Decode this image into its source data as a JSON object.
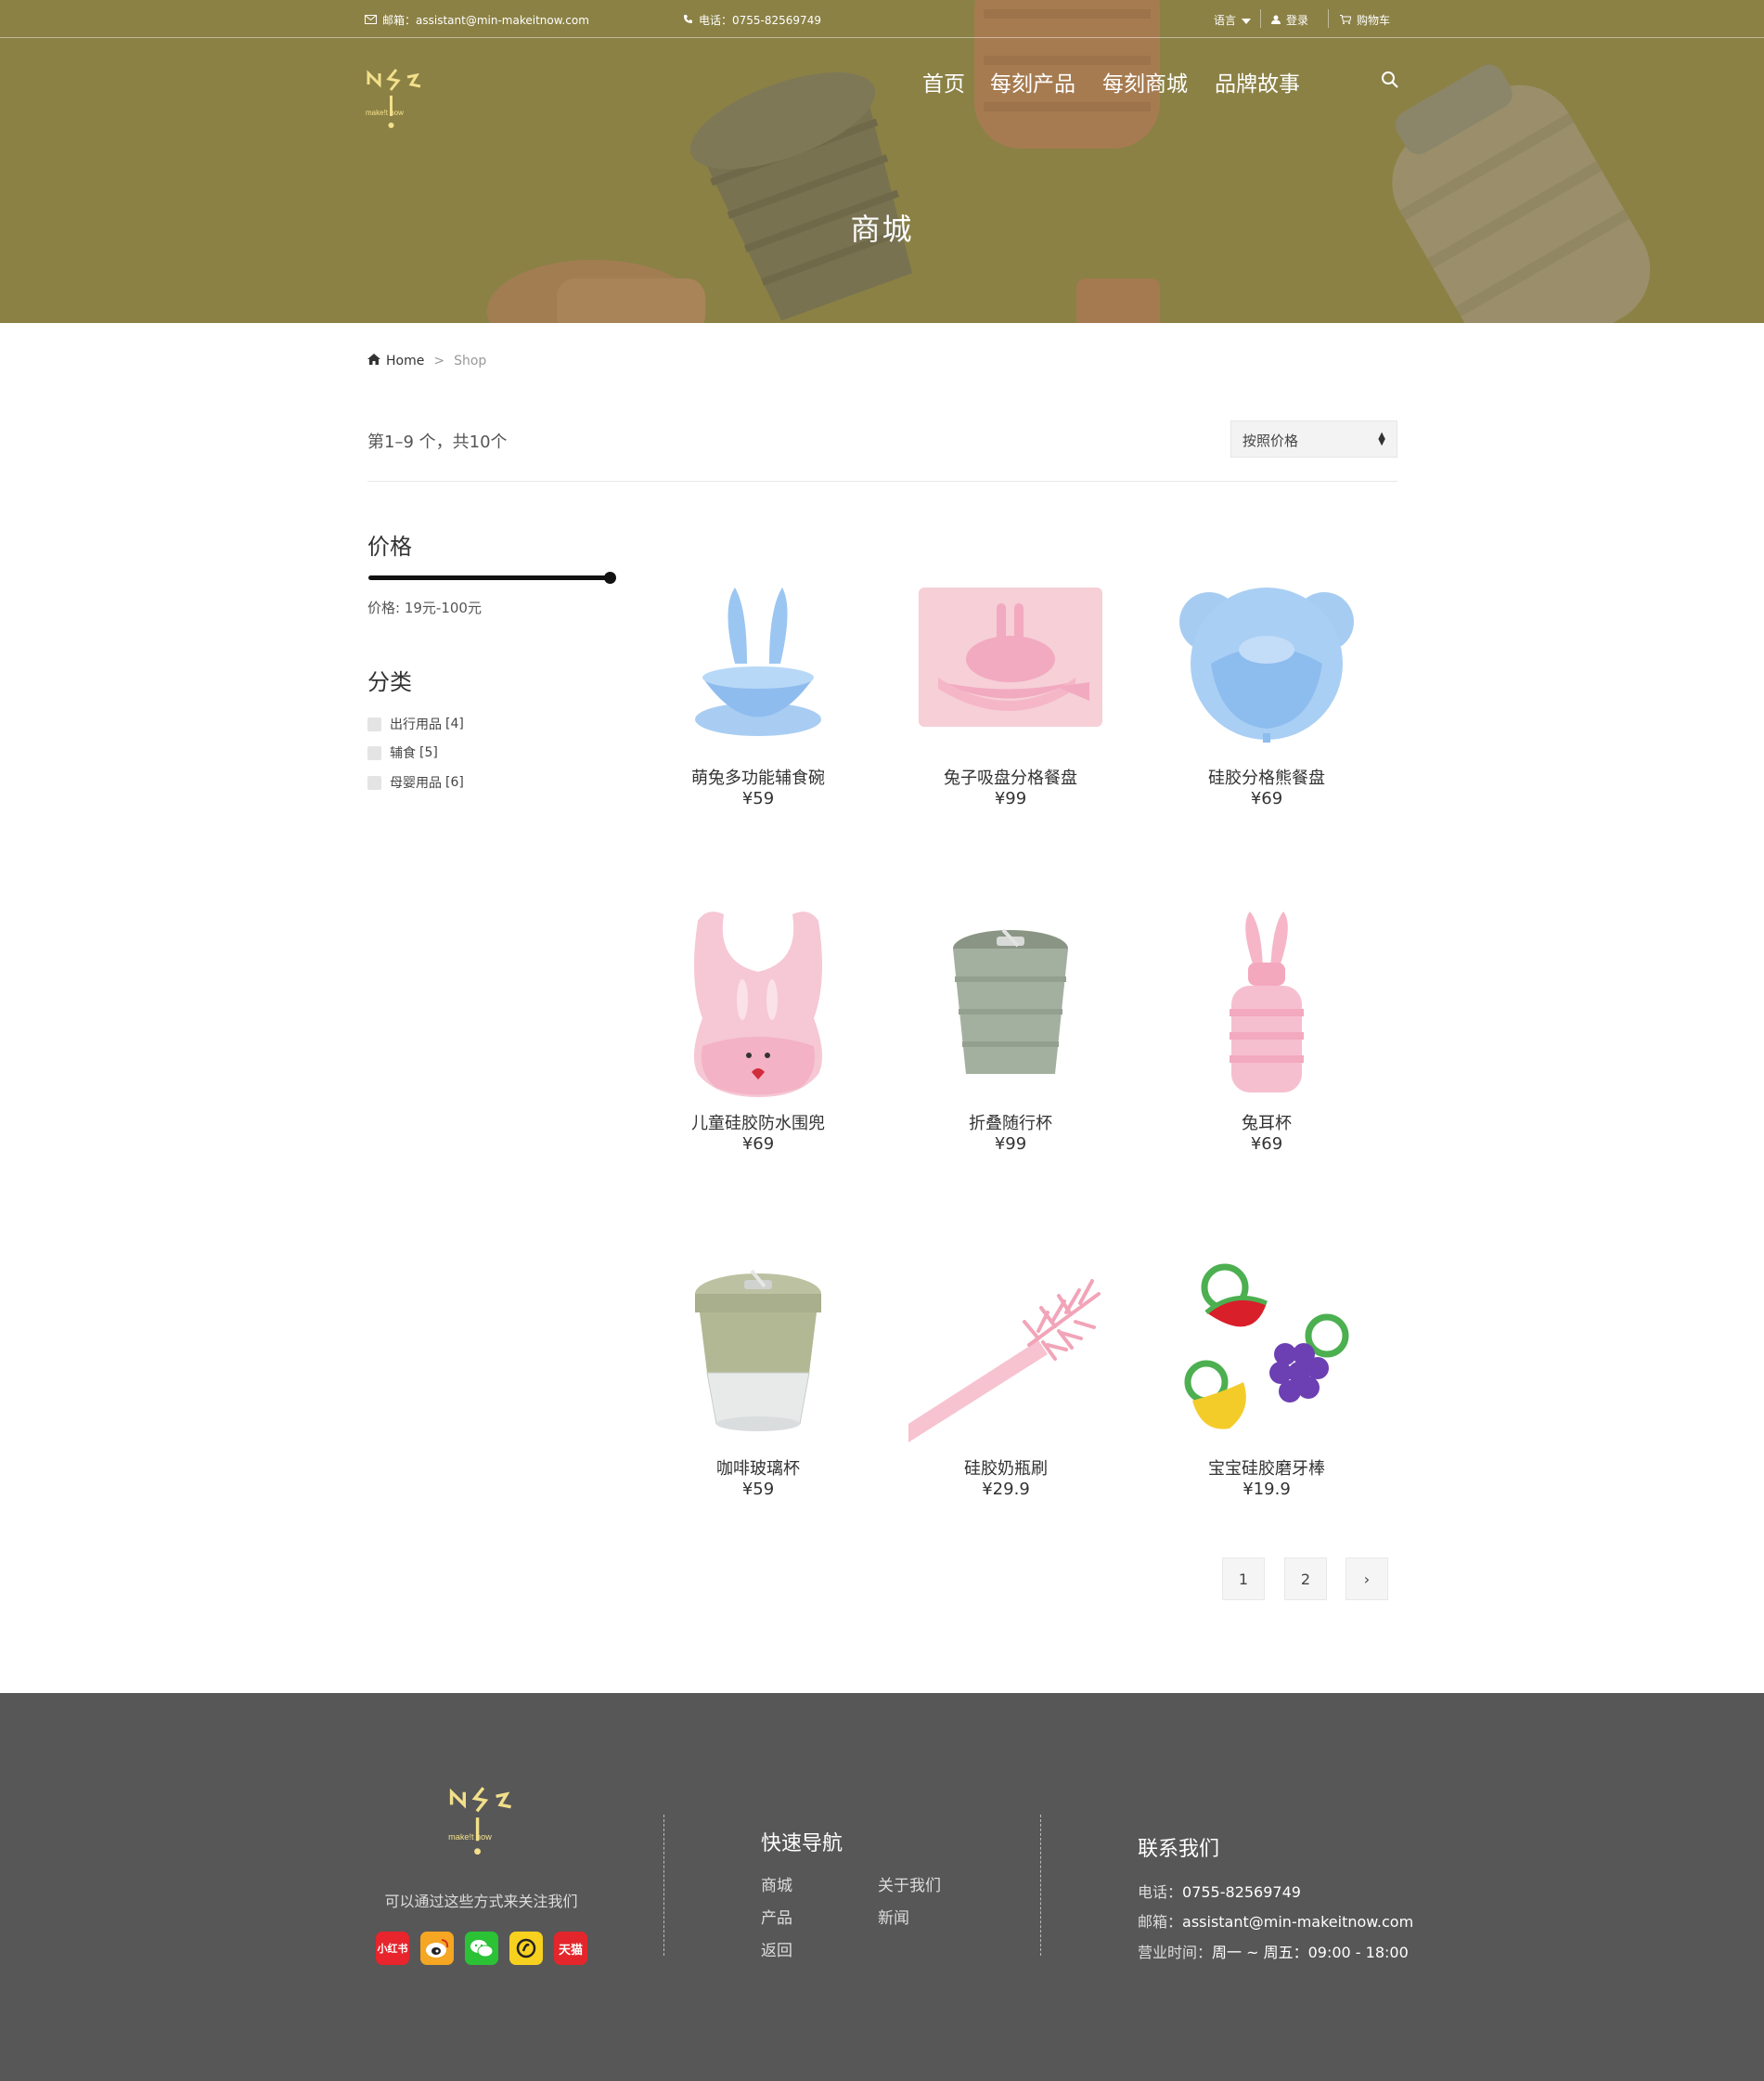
{
  "topbar": {
    "email_label": "邮箱：",
    "email": "assistant@min-makeitnow.com",
    "phone_label": "电话：",
    "phone": "0755-82569749",
    "language": "语言",
    "login": "登录",
    "cart": "购物车"
  },
  "brand": {
    "logo_text": "make!t now"
  },
  "nav": {
    "items": [
      "首页",
      "每刻产品",
      "每刻商城",
      "品牌故事"
    ]
  },
  "hero": {
    "title": "商城"
  },
  "breadcrumb": {
    "home": "Home",
    "sep": ">",
    "current": "Shop"
  },
  "toolbar": {
    "result_count": "第1–9 个，共10个",
    "sort_selected": "按照价格"
  },
  "sidebar": {
    "price_title": "价格",
    "price_label": "价格:",
    "price_range": "19元-100元",
    "price_slider": {
      "min": 19,
      "max": 100,
      "low": 19,
      "high": 100
    },
    "category_title": "分类",
    "categories": [
      {
        "label": "出行用品",
        "count": "[4]"
      },
      {
        "label": "辅食",
        "count": "[5]"
      },
      {
        "label": "母婴用品",
        "count": "[6]"
      }
    ]
  },
  "products": [
    {
      "name": "萌兔多功能辅食碗",
      "price": "¥59"
    },
    {
      "name": "兔子吸盘分格餐盘",
      "price": "¥99"
    },
    {
      "name": "硅胶分格熊餐盘",
      "price": "¥69"
    },
    {
      "name": "儿童硅胶防水围兜",
      "price": "¥69"
    },
    {
      "name": "折叠随行杯",
      "price": "¥99"
    },
    {
      "name": "兔耳杯",
      "price": "¥69"
    },
    {
      "name": "咖啡玻璃杯",
      "price": "¥59"
    },
    {
      "name": "硅胶奶瓶刷",
      "price": "¥29.9"
    },
    {
      "name": "宝宝硅胶磨牙棒",
      "price": "¥19.9"
    }
  ],
  "pagination": {
    "pages": [
      "1",
      "2"
    ],
    "next": "›"
  },
  "footer": {
    "follow_text": "可以通过这些方式来关注我们",
    "socials": [
      {
        "name": "xiaohongshu-icon",
        "label": "小红书",
        "color": "#e8242c"
      },
      {
        "name": "weibo-icon",
        "label": "",
        "color": "#f5a623"
      },
      {
        "name": "wechat-icon",
        "label": "",
        "color": "#2bc236"
      },
      {
        "name": "douyin-icon",
        "label": "",
        "color": "#f7d11e"
      },
      {
        "name": "tmall-icon",
        "label": "天猫",
        "color": "#e3262b"
      }
    ],
    "nav_title": "快速导航",
    "nav_links": [
      "商城",
      "关于我们",
      "产品",
      "新闻",
      "返回"
    ],
    "contact_title": "联系我们",
    "phone_label": "电话：",
    "phone": "0755-82569749",
    "email_label": "邮箱：",
    "email": "assistant@min-makeitnow.com",
    "hours_label": "营业时间：",
    "hours": "周一 ~ 周五：09:00 - 18:00"
  },
  "colors": {
    "hero_bg": "#8a7f45",
    "footer_bg": "#575757",
    "logo_yellow": "#f2e08a"
  }
}
